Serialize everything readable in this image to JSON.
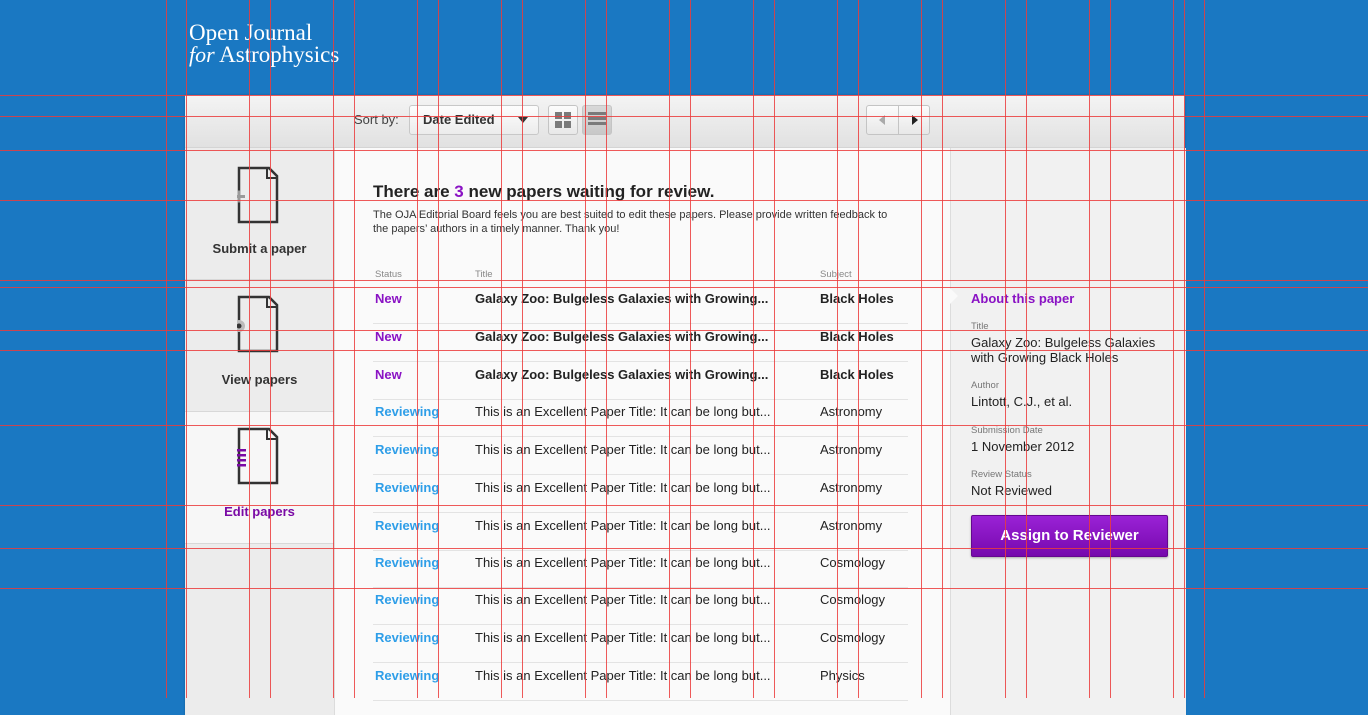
{
  "brand": {
    "line1": "Open Journal",
    "line2_italic": "for",
    "line2": "Astrophysics"
  },
  "toolbar": {
    "sort_label": "Sort by:",
    "sort_value": "Date Edited",
    "view_grid_icon": "grid-view-icon",
    "view_list_icon": "list-view-icon",
    "prev_icon": "arrow-left-icon",
    "next_icon": "arrow-right-icon"
  },
  "sidebar": {
    "items": [
      {
        "label": "Submit a paper",
        "icon": "document-add-icon"
      },
      {
        "label": "View papers",
        "icon": "document-view-icon"
      },
      {
        "label": "Edit papers",
        "icon": "document-edit-icon",
        "active": true
      }
    ]
  },
  "main": {
    "headline_prefix": "There are",
    "headline_count": "3",
    "headline_suffix": "new papers waiting for review.",
    "subtext": "The OJA Editorial Board feels you are best suited to edit these papers. Please provide written feedback to the papers’ authors in a timely manner. Thank you!",
    "columns": [
      "Status",
      "Title",
      "Subject"
    ],
    "rows": [
      {
        "status": "New",
        "title": "Galaxy Zoo: Bulgeless Galaxies with Growing...",
        "subject": "Black Holes"
      },
      {
        "status": "New",
        "title": "Galaxy Zoo: Bulgeless Galaxies with Growing...",
        "subject": "Black Holes"
      },
      {
        "status": "New",
        "title": "Galaxy Zoo: Bulgeless Galaxies with Growing...",
        "subject": "Black Holes"
      },
      {
        "status": "Reviewing",
        "title": "This is an Excellent Paper Title: It can be long but...",
        "subject": "Astronomy"
      },
      {
        "status": "Reviewing",
        "title": "This is an Excellent Paper Title: It can be long but...",
        "subject": "Astronomy"
      },
      {
        "status": "Reviewing",
        "title": "This is an Excellent Paper Title: It can be long but...",
        "subject": "Astronomy"
      },
      {
        "status": "Reviewing",
        "title": "This is an Excellent Paper Title: It can be long but...",
        "subject": "Astronomy"
      },
      {
        "status": "Reviewing",
        "title": "This is an Excellent Paper Title: It can be long but...",
        "subject": "Cosmology"
      },
      {
        "status": "Reviewing",
        "title": "This is an Excellent Paper Title: It can be long but...",
        "subject": "Cosmology"
      },
      {
        "status": "Reviewing",
        "title": "This is an Excellent Paper Title: It can be long but...",
        "subject": "Cosmology"
      },
      {
        "status": "Reviewing",
        "title": "This is an Excellent Paper Title: It can be long but...",
        "subject": "Physics"
      }
    ]
  },
  "detail": {
    "heading": "About this paper",
    "title_label": "Title",
    "title_value": "Galaxy Zoo: Bulgeless Galaxies with Growing Black Holes",
    "author_label": "Author",
    "author_value": "Lintott, C.J., et al.",
    "date_label": "Submission Date",
    "date_value": "1 November 2012",
    "status_label": "Review Status",
    "status_value": "Not Reviewed",
    "button_label": "Assign to Reviewer"
  },
  "colors": {
    "background": "#1a78c2",
    "accent_purple": "#8a12c4",
    "reviewing_blue": "#2e9ee8",
    "guide_red": "#eb3c3c"
  }
}
